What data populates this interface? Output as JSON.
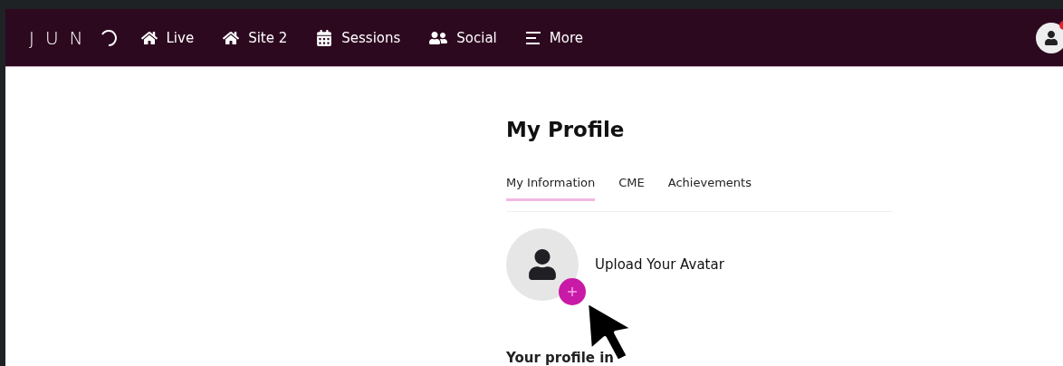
{
  "logo": {
    "text": "JUN"
  },
  "nav": [
    {
      "label": "Live",
      "kind": "home"
    },
    {
      "label": "Site 2",
      "kind": "home"
    },
    {
      "label": "Sessions",
      "kind": "calendar"
    },
    {
      "label": "Social",
      "kind": "people"
    },
    {
      "label": "More",
      "kind": "menu"
    }
  ],
  "profile": {
    "title": "My Profile",
    "tabs": [
      {
        "label": "My Information",
        "selected": true
      },
      {
        "label": "CME",
        "selected": false
      },
      {
        "label": "Achievements",
        "selected": false
      }
    ],
    "avatar_upload": {
      "label": "Upload Your Avatar"
    },
    "section_heading": "Your profile in"
  }
}
